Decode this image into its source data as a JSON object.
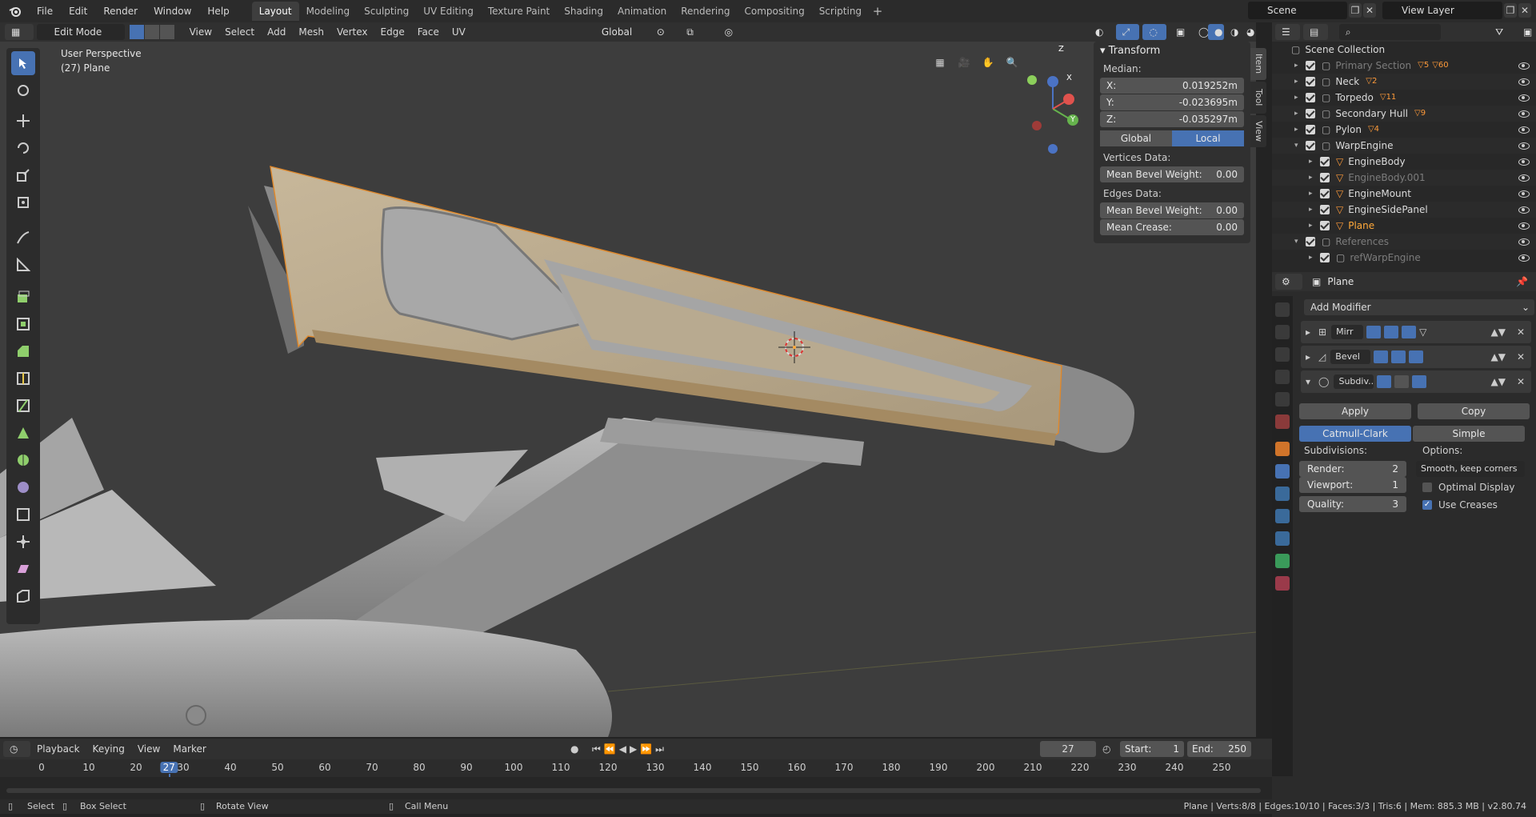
{
  "topbar": {
    "menus": [
      "File",
      "Edit",
      "Render",
      "Window",
      "Help"
    ],
    "workspaces": [
      "Layout",
      "Modeling",
      "Sculpting",
      "UV Editing",
      "Texture Paint",
      "Shading",
      "Animation",
      "Rendering",
      "Compositing",
      "Scripting"
    ],
    "active_workspace": "Layout",
    "scene": "Scene",
    "view_layer": "View Layer"
  },
  "viewport_header": {
    "mode": "Edit Mode",
    "menus": [
      "View",
      "Select",
      "Add",
      "Mesh",
      "Vertex",
      "Edge",
      "Face",
      "UV"
    ],
    "orientation": "Global"
  },
  "viewport": {
    "perspective": "User Perspective",
    "object": "(27) Plane",
    "gizmo_axes": [
      "X",
      "Y",
      "Z"
    ]
  },
  "side_tabs": [
    "Item",
    "Tool",
    "View"
  ],
  "transform_panel": {
    "title": "Transform",
    "median_label": "Median:",
    "x_label": "X:",
    "x": "0.019252m",
    "y_label": "Y:",
    "y": "-0.023695m",
    "z_label": "Z:",
    "z": "-0.035297m",
    "global": "Global",
    "local": "Local",
    "vertices_data": "Vertices Data:",
    "mean_bevel_weight": "Mean Bevel Weight:",
    "v_bevel_value": "0.00",
    "edges_data": "Edges Data:",
    "e_bevel_value": "0.00",
    "mean_crease": "Mean Crease:",
    "crease_value": "0.00"
  },
  "outliner": {
    "root": "Scene Collection",
    "items": [
      {
        "name": "Primary Section",
        "badge": "5",
        "badge2": "60",
        "dim": true
      },
      {
        "name": "Neck",
        "badge": "2"
      },
      {
        "name": "Torpedo",
        "badge": "11"
      },
      {
        "name": "Secondary Hull",
        "badge": "9"
      },
      {
        "name": "Pylon",
        "badge": "4"
      },
      {
        "name": "WarpEngine"
      },
      {
        "name": "EngineBody"
      },
      {
        "name": "EngineBody.001",
        "dim": true
      },
      {
        "name": "EngineMount"
      },
      {
        "name": "EngineSidePanel"
      },
      {
        "name": "Plane",
        "selected": true
      },
      {
        "name": "References",
        "dim": true
      },
      {
        "name": "refWarpEngine",
        "dim": true
      }
    ]
  },
  "properties": {
    "object_name": "Plane",
    "add_modifier": "Add Modifier",
    "modifiers": [
      "Mirr",
      "Bevel",
      "Subdiv.."
    ],
    "apply": "Apply",
    "copy": "Copy",
    "catmull": "Catmull-Clark",
    "simple": "Simple",
    "subdivisions_label": "Subdivisions:",
    "options_label": "Options:",
    "render_label": "Render:",
    "render_value": "2",
    "viewport_label": "Viewport:",
    "viewport_value": "1",
    "quality_label": "Quality:",
    "quality_value": "3",
    "uv_smooth": "Smooth, keep corners",
    "optimal_display": "Optimal Display",
    "use_creases": "Use Creases"
  },
  "timeline": {
    "menus": [
      "Playback",
      "Keying",
      "View",
      "Marker"
    ],
    "current_frame": "27",
    "start_label": "Start:",
    "start": "1",
    "end_label": "End:",
    "end": "250",
    "ruler": [
      "0",
      "10",
      "20",
      "27",
      "30",
      "40",
      "50",
      "60",
      "70",
      "80",
      "90",
      "100",
      "110",
      "120",
      "130",
      "140",
      "150",
      "160",
      "170",
      "180",
      "190",
      "200",
      "210",
      "220",
      "230",
      "240",
      "250"
    ]
  },
  "statusbar": {
    "select": "Select",
    "box_select": "Box Select",
    "rotate_view": "Rotate View",
    "call_menu": "Call Menu",
    "stats": "Plane | Verts:8/8 | Edges:10/10 | Faces:3/3 | Tris:6 | Mem: 885.3 MB | v2.80.74"
  },
  "colors": {
    "accent": "#4772b3",
    "selection": "#ffa93a",
    "panel": "#303030",
    "viewport": "#3d3d3d"
  }
}
